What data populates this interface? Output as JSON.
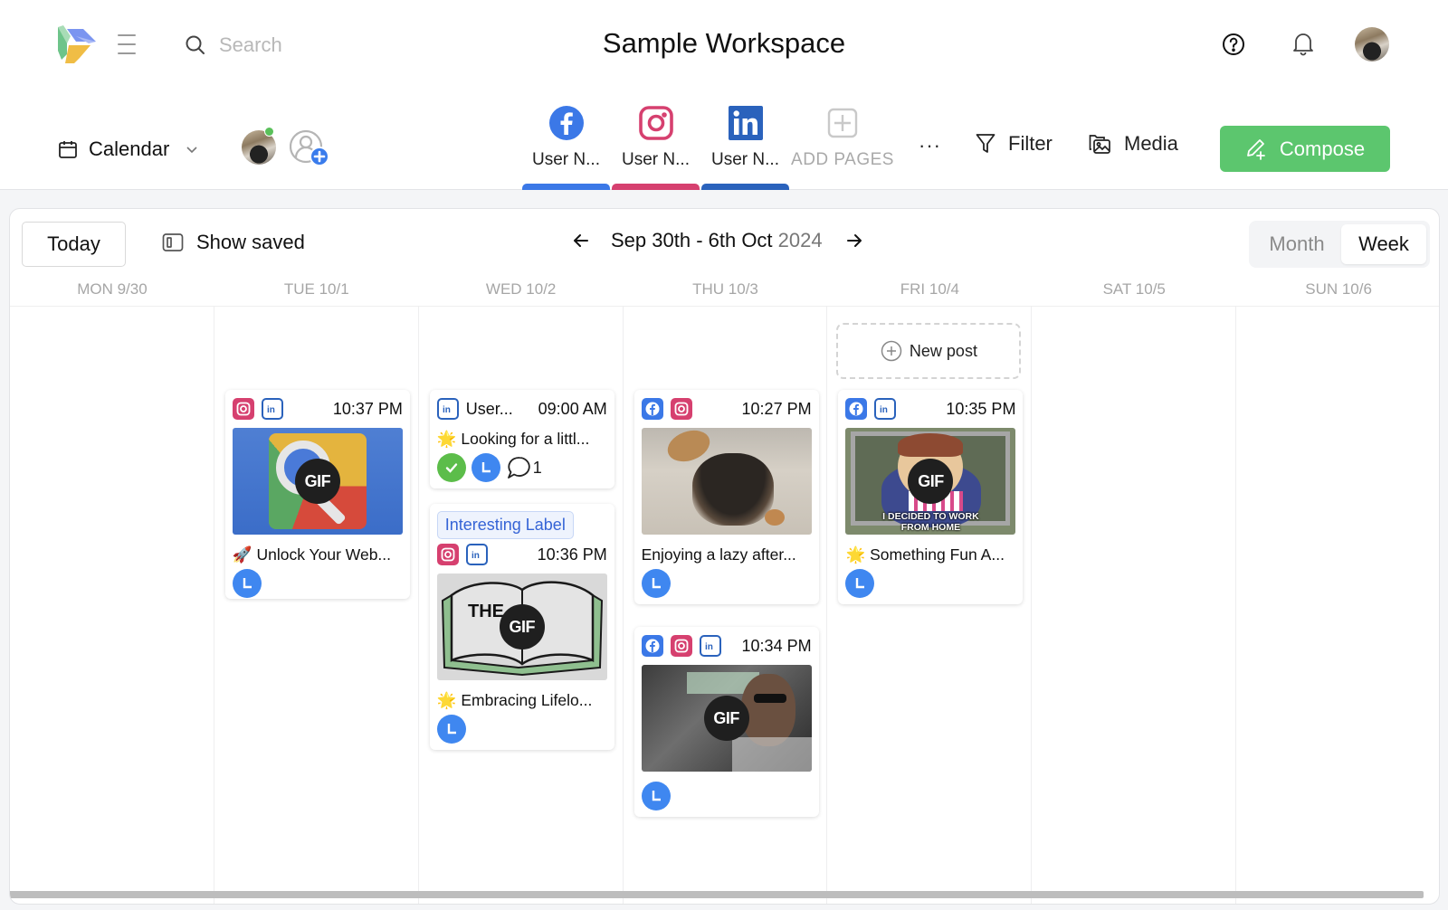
{
  "header": {
    "logo_icon": "app-logo",
    "menu_icon": "hamburger-icon",
    "search": {
      "placeholder": "Search",
      "value": "",
      "icon": "search-icon"
    },
    "workspace_title": "Sample Workspace",
    "help_icon": "help-circle-icon",
    "notifications_icon": "bell-icon",
    "avatar": "user-avatar"
  },
  "toolbar": {
    "view_dropdown": {
      "label": "Calendar",
      "icon": "calendar-icon"
    },
    "pages": [
      {
        "network": "facebook",
        "label": "User N...",
        "color": "#3b78e7"
      },
      {
        "network": "instagram",
        "label": "User N...",
        "color": "#d6406f"
      },
      {
        "network": "linkedin",
        "label": "User N...",
        "color": "#2a62bc"
      }
    ],
    "add_pages_label": "ADD PAGES",
    "more_label": "···",
    "filter_label": "Filter",
    "media_label": "Media",
    "compose_label": "Compose",
    "compose_color": "#5cc66e"
  },
  "calendar": {
    "today_label": "Today",
    "show_saved_label": "Show saved",
    "range_label": "Sep 30th - 6th Oct",
    "range_year": "2024",
    "view_options": [
      "Month",
      "Week"
    ],
    "active_view": "Week",
    "days": [
      "MON 9/30",
      "TUE 10/1",
      "WED 10/2",
      "THU 10/3",
      "FRI 10/4",
      "SAT 10/5",
      "SUN 10/6"
    ],
    "new_post_label": "New post",
    "posts": {
      "tue_1": {
        "networks": [
          "instagram",
          "linkedin"
        ],
        "time": "10:37 PM",
        "media": "gif",
        "caption": "🚀 Unlock Your Web...",
        "status": [
          "scheduled"
        ]
      },
      "wed_1": {
        "networks": [
          "linkedin"
        ],
        "user": "User...",
        "time": "09:00 AM",
        "caption": "🌟 Looking for a littl...",
        "status": [
          "approved",
          "scheduled"
        ],
        "comments": "1"
      },
      "wed_2": {
        "label": "Interesting Label",
        "networks": [
          "instagram",
          "linkedin"
        ],
        "time": "10:36 PM",
        "media": "gif",
        "caption": "🌟 Embracing Lifelo...",
        "status": [
          "scheduled"
        ]
      },
      "thu_1": {
        "networks": [
          "facebook",
          "instagram"
        ],
        "time": "10:27 PM",
        "media": "image",
        "caption": "Enjoying a lazy after...",
        "status": [
          "scheduled"
        ]
      },
      "thu_2": {
        "networks": [
          "facebook",
          "instagram",
          "linkedin"
        ],
        "time": "10:34 PM",
        "media": "gif",
        "status": [
          "scheduled"
        ]
      },
      "fri_1": {
        "networks": [
          "facebook",
          "linkedin"
        ],
        "time": "10:35 PM",
        "media": "gif",
        "media_text": "I DECIDED TO WORK FROM HOME",
        "caption": "🌟 Something Fun A...",
        "status": [
          "scheduled"
        ]
      }
    },
    "gif_badge": "GIF",
    "book_text": "THE"
  }
}
